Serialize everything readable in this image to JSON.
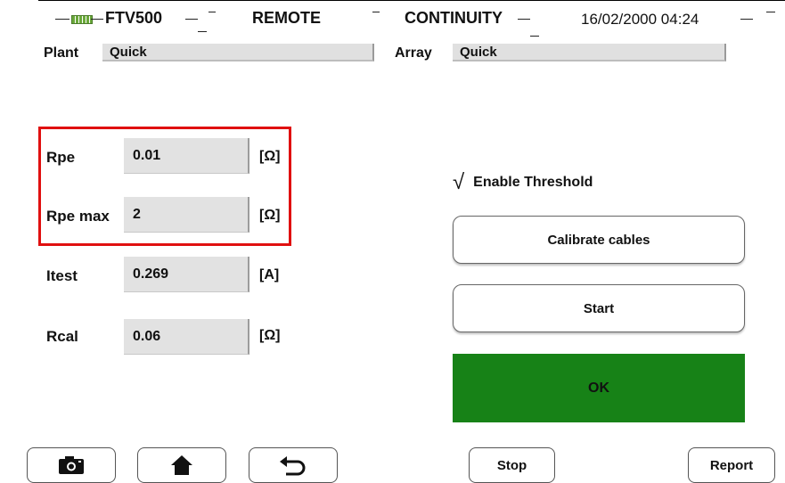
{
  "status_bar": {
    "device": "FTV500",
    "mode": "REMOTE",
    "function": "CONTINUITY",
    "datetime": "16/02/2000 04:24"
  },
  "header": {
    "plant_label": "Plant",
    "plant_value": "Quick",
    "array_label": "Array",
    "array_value": "Quick"
  },
  "params": {
    "rpe": {
      "label": "Rpe",
      "value": "0.01",
      "unit": "[Ω]"
    },
    "rpe_max": {
      "label": "Rpe max",
      "value": "2",
      "unit": "[Ω]"
    },
    "itest": {
      "label": "Itest",
      "value": "0.269",
      "unit": "[A]"
    },
    "rcal": {
      "label": "Rcal",
      "value": "0.06",
      "unit": "[Ω]"
    }
  },
  "right_panel": {
    "threshold_check": "√",
    "threshold_label": "Enable Threshold",
    "calibrate_label": "Calibrate cables",
    "start_label": "Start",
    "result_label": "OK",
    "result_color": "#178217"
  },
  "footer": {
    "camera_icon": "camera-icon",
    "home_icon": "home-icon",
    "back_icon": "back-arrow-icon",
    "stop_label": "Stop",
    "report_label": "Report"
  },
  "colors": {
    "highlight_border": "#e01010",
    "field_background": "#e2e2e2"
  }
}
